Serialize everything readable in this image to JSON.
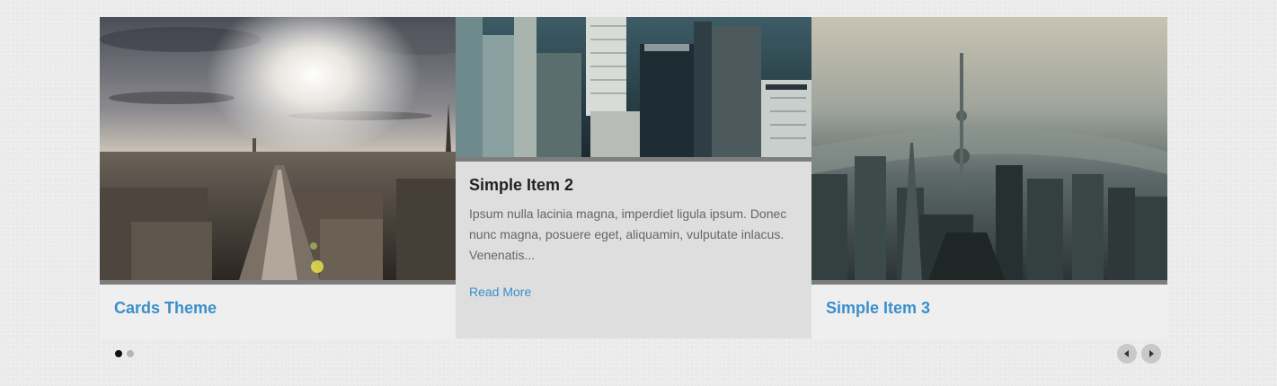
{
  "carousel": {
    "items": [
      {
        "title": "Cards Theme",
        "image": "paris-skyline-photo"
      },
      {
        "title": "Simple Item 2",
        "image": "nyc-skyscrapers-photo",
        "text": "Ipsum nulla lacinia magna, imperdiet ligula ipsum. Donec nunc magna, posuere eget, aliquamin, vulputate inlacus. Venenatis...",
        "link": "Read More"
      },
      {
        "title": "Simple Item 3",
        "image": "shanghai-aerial-photo"
      }
    ],
    "pagination": {
      "total": 2,
      "active_index": 0
    },
    "nav": {
      "prev_icon": "arrow-left-icon",
      "next_icon": "arrow-right-icon"
    }
  },
  "colors": {
    "link": "#3a8fcb",
    "active_card_bg": "#dedede",
    "card_bg": "#efefef",
    "page_bg": "#ececec"
  }
}
